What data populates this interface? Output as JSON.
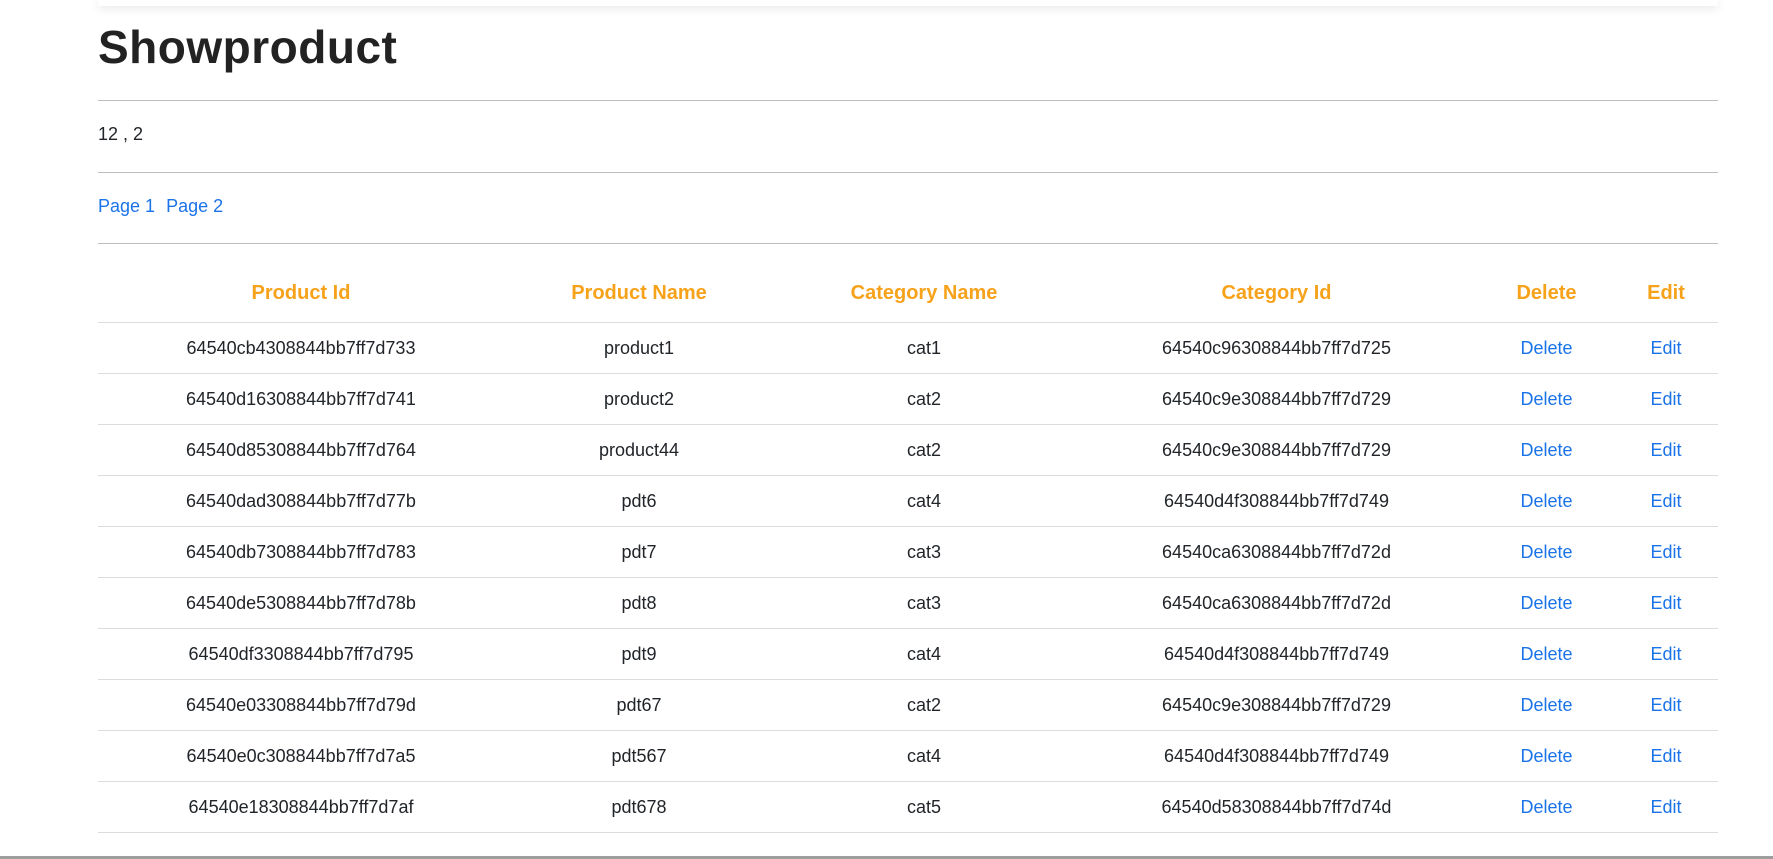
{
  "page": {
    "title": "Showproduct",
    "counts": "12 , 2",
    "pages": [
      "Page 1",
      "Page 2"
    ]
  },
  "table": {
    "headers": [
      "Product Id",
      "Product Name",
      "Category Name",
      "Category Id",
      "Delete",
      "Edit"
    ],
    "rows": [
      {
        "product_id": "64540cb4308844bb7ff7d733",
        "product_name": "product1",
        "category_name": "cat1",
        "category_id": "64540c96308844bb7ff7d725",
        "delete": "Delete",
        "edit": "Edit"
      },
      {
        "product_id": "64540d16308844bb7ff7d741",
        "product_name": "product2",
        "category_name": "cat2",
        "category_id": "64540c9e308844bb7ff7d729",
        "delete": "Delete",
        "edit": "Edit"
      },
      {
        "product_id": "64540d85308844bb7ff7d764",
        "product_name": "product44",
        "category_name": "cat2",
        "category_id": "64540c9e308844bb7ff7d729",
        "delete": "Delete",
        "edit": "Edit"
      },
      {
        "product_id": "64540dad308844bb7ff7d77b",
        "product_name": "pdt6",
        "category_name": "cat4",
        "category_id": "64540d4f308844bb7ff7d749",
        "delete": "Delete",
        "edit": "Edit"
      },
      {
        "product_id": "64540db7308844bb7ff7d783",
        "product_name": "pdt7",
        "category_name": "cat3",
        "category_id": "64540ca6308844bb7ff7d72d",
        "delete": "Delete",
        "edit": "Edit"
      },
      {
        "product_id": "64540de5308844bb7ff7d78b",
        "product_name": "pdt8",
        "category_name": "cat3",
        "category_id": "64540ca6308844bb7ff7d72d",
        "delete": "Delete",
        "edit": "Edit"
      },
      {
        "product_id": "64540df3308844bb7ff7d795",
        "product_name": "pdt9",
        "category_name": "cat4",
        "category_id": "64540d4f308844bb7ff7d749",
        "delete": "Delete",
        "edit": "Edit"
      },
      {
        "product_id": "64540e03308844bb7ff7d79d",
        "product_name": "pdt67",
        "category_name": "cat2",
        "category_id": "64540c9e308844bb7ff7d729",
        "delete": "Delete",
        "edit": "Edit"
      },
      {
        "product_id": "64540e0c308844bb7ff7d7a5",
        "product_name": "pdt567",
        "category_name": "cat4",
        "category_id": "64540d4f308844bb7ff7d749",
        "delete": "Delete",
        "edit": "Edit"
      },
      {
        "product_id": "64540e18308844bb7ff7d7af",
        "product_name": "pdt678",
        "category_name": "cat5",
        "category_id": "64540d58308844bb7ff7d74d",
        "delete": "Delete",
        "edit": "Edit"
      }
    ]
  },
  "colors": {
    "header_text": "#f7a21b",
    "link": "#1a73e8"
  }
}
